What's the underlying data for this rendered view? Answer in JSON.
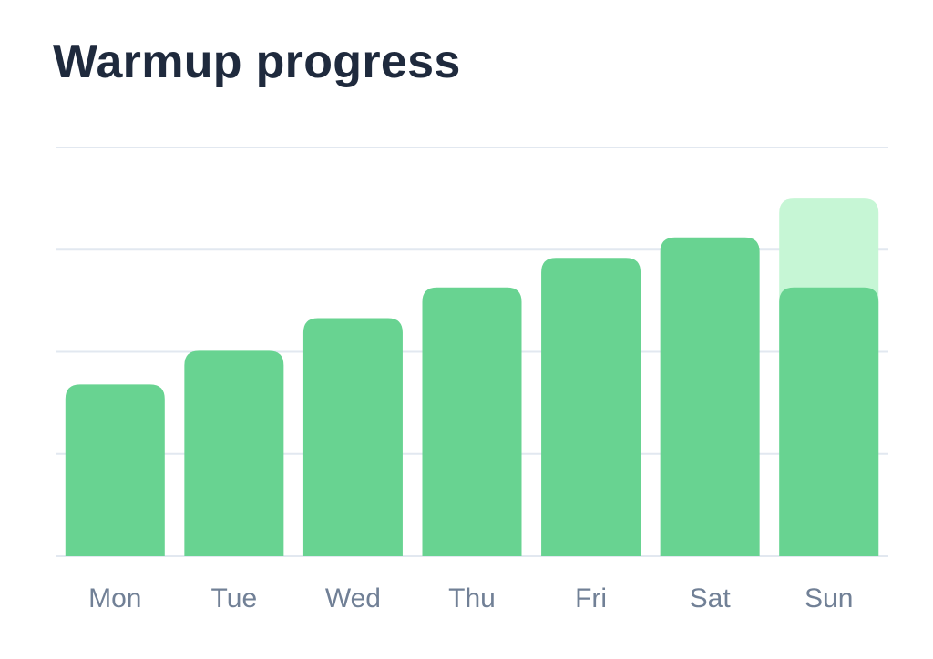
{
  "chart_data": {
    "type": "bar",
    "title": "Warmup progress",
    "categories": [
      "Mon",
      "Tue",
      "Wed",
      "Thu",
      "Fri",
      "Sat",
      "Sun"
    ],
    "series": [
      {
        "values": [
          1.68,
          2.01,
          2.33,
          2.63,
          2.92,
          3.12,
          2.63
        ]
      },
      {
        "values": [
          null,
          null,
          null,
          null,
          null,
          null,
          3.5
        ]
      }
    ],
    "ylim": [
      0,
      4
    ],
    "grid": true,
    "colors": {
      "bar": "#68d391",
      "projected": "#c6f6d5",
      "grid": "#e2e8f0",
      "title": "#1f2a3d",
      "ticks": "#718096"
    }
  }
}
